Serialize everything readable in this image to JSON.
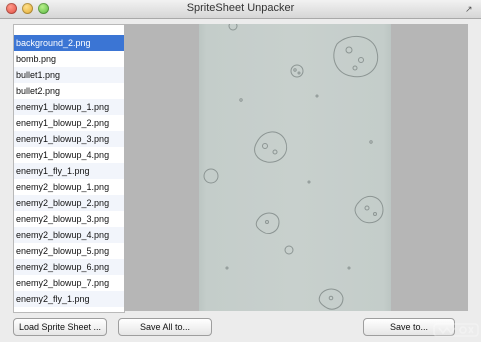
{
  "window": {
    "title": "SpriteSheet Unpacker"
  },
  "icons": {
    "close": "close-icon",
    "minimize": "minimize-icon",
    "zoom": "zoom-icon",
    "fullscreen": "fullscreen-icon"
  },
  "file_list": {
    "selected_index": 0,
    "items": [
      "background_2.png",
      "bomb.png",
      "bullet1.png",
      "bullet2.png",
      "enemy1_blowup_1.png",
      "enemy1_blowup_2.png",
      "enemy1_blowup_3.png",
      "enemy1_blowup_4.png",
      "enemy1_fly_1.png",
      "enemy2_blowup_1.png",
      "enemy2_blowup_2.png",
      "enemy2_blowup_3.png",
      "enemy2_blowup_4.png",
      "enemy2_blowup_5.png",
      "enemy2_blowup_6.png",
      "enemy2_blowup_7.png",
      "enemy2_fly_1.png"
    ]
  },
  "buttons": {
    "load": "Load Sprite Sheet ...",
    "save_all": "Save All to...",
    "save_to": "Save to..."
  },
  "colors": {
    "selection": "#3b75d4",
    "preview_bg": "#b6b6b6",
    "sprite_bg": "#c8d0cd"
  }
}
